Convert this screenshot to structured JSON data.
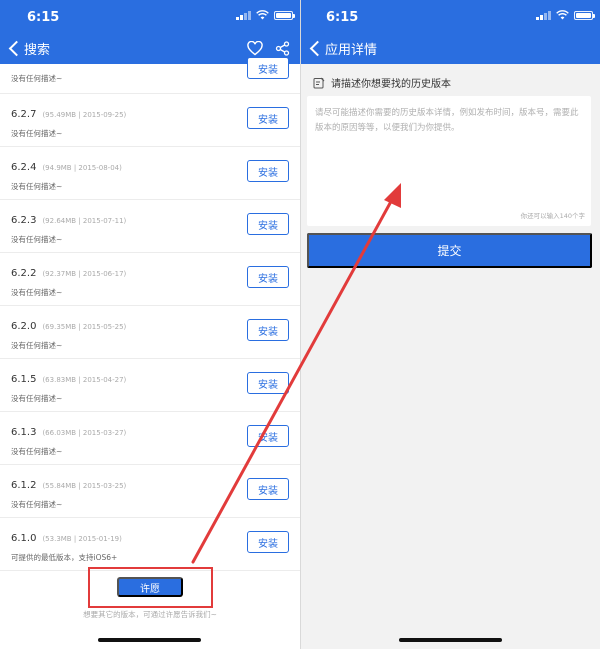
{
  "left_screen": {
    "status_time": "6:15",
    "nav_back_label": "搜索",
    "partial_row_desc": "没有任何描述~",
    "install_label": "安装",
    "versions": [
      {
        "version": "6.2.7",
        "meta": "(95.49MB | 2015-09-25)",
        "desc": "没有任何描述~"
      },
      {
        "version": "6.2.4",
        "meta": "(94.9MB | 2015-08-04)",
        "desc": "没有任何描述~"
      },
      {
        "version": "6.2.3",
        "meta": "(92.64MB | 2015-07-11)",
        "desc": "没有任何描述~"
      },
      {
        "version": "6.2.2",
        "meta": "(92.37MB | 2015-06-17)",
        "desc": "没有任何描述~"
      },
      {
        "version": "6.2.0",
        "meta": "(69.35MB | 2015-05-25)",
        "desc": "没有任何描述~"
      },
      {
        "version": "6.1.5",
        "meta": "(63.83MB | 2015-04-27)",
        "desc": "没有任何描述~"
      },
      {
        "version": "6.1.3",
        "meta": "(66.03MB | 2015-03-27)",
        "desc": "没有任何描述~"
      },
      {
        "version": "6.1.2",
        "meta": "(55.84MB | 2015-03-25)",
        "desc": "没有任何描述~"
      },
      {
        "version": "6.1.0",
        "meta": "(53.3MB | 2015-01-19)",
        "desc": "可提供的最低版本，支持iOS6+"
      }
    ],
    "wish_button": "许愿",
    "footer_hint": "想要其它的版本，可通过许愿告诉我们~"
  },
  "right_screen": {
    "status_time": "6:15",
    "nav_back_label": "应用详情",
    "describe_label": "请描述你想要找的历史版本",
    "textarea_placeholder": "请尽可能描述你需要的历史版本详情，例如发布时间，版本号，需要此版本的原因等等，以便我们为你提供。",
    "char_counter": "你还可以输入140个字",
    "submit_button": "提交"
  },
  "colors": {
    "brand_blue": "#2a6ee0",
    "annotation_red": "#e23b3b"
  },
  "icons": [
    "back-chevron-icon",
    "heart-icon",
    "share-icon",
    "signal-icon",
    "wifi-icon",
    "battery-icon",
    "edit-note-icon"
  ]
}
